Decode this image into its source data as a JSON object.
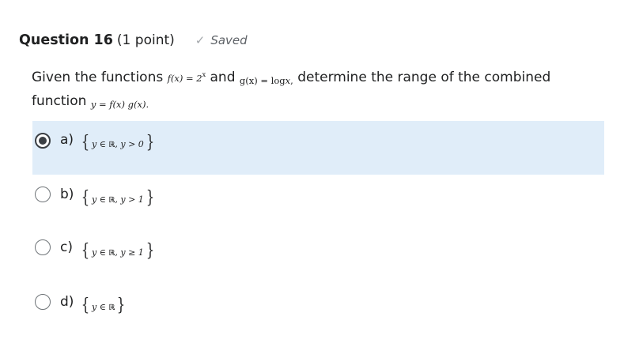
{
  "question": {
    "title": "Question 16",
    "points": "(1 point)",
    "status": "Saved",
    "stem": {
      "part1": "Given the functions",
      "f_lhs": "f(x) = 2",
      "f_exp": "x",
      "and": "and",
      "g": "g(x) = log",
      "g_var": "x",
      "g_tail": ",",
      "part2": "determine the range of the combined",
      "part3": "function",
      "y": "y = f(x) g(x)",
      "end": "."
    }
  },
  "options": [
    {
      "letter": "a)",
      "var": "y",
      "in": "∈",
      "set": "ℝ",
      "cond": ", y > 0",
      "selected": true
    },
    {
      "letter": "b)",
      "var": "y",
      "in": "∈",
      "set": "ℝ",
      "cond": ", y > 1",
      "selected": false
    },
    {
      "letter": "c)",
      "var": "y",
      "in": "∈",
      "set": "ℝ",
      "cond": ", y ≥ 1",
      "selected": false
    },
    {
      "letter": "d)",
      "var": "y",
      "in": "∈",
      "set": "ℝ",
      "cond": "",
      "selected": false
    }
  ],
  "colors": {
    "selected_bg": "#e0edf9",
    "text": "#202122",
    "saved_text": "#5f6368",
    "check": "#a3a7ab"
  },
  "icons": {
    "saved": "checkmark-icon",
    "radio_checked": "radio-checked-icon",
    "radio_unchecked": "radio-unchecked-icon"
  }
}
